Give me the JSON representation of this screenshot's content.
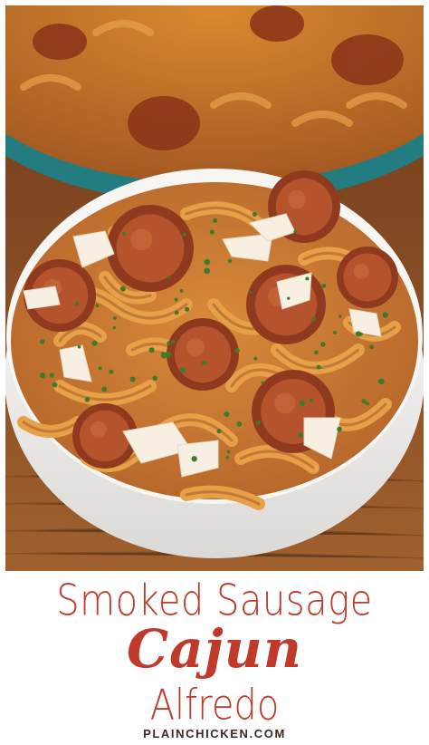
{
  "photo": {
    "subject": "bowl-of-pasta-with-sausage",
    "colors": {
      "table": "#7a3f1c",
      "bowl": "#f4f3f1",
      "sauce": "#c7782f",
      "sausage": "#8f3a1f",
      "skillet": "#2b8f93",
      "cheese": "#f6efe2",
      "herb": "#3f7a2a"
    }
  },
  "caption": {
    "line1": "Smoked Sausage",
    "line2": "Cajun",
    "line3": "Alfredo",
    "site": "PLAINCHICKEN.COM",
    "color": "#c0392b",
    "site_color": "#3a2a22"
  }
}
